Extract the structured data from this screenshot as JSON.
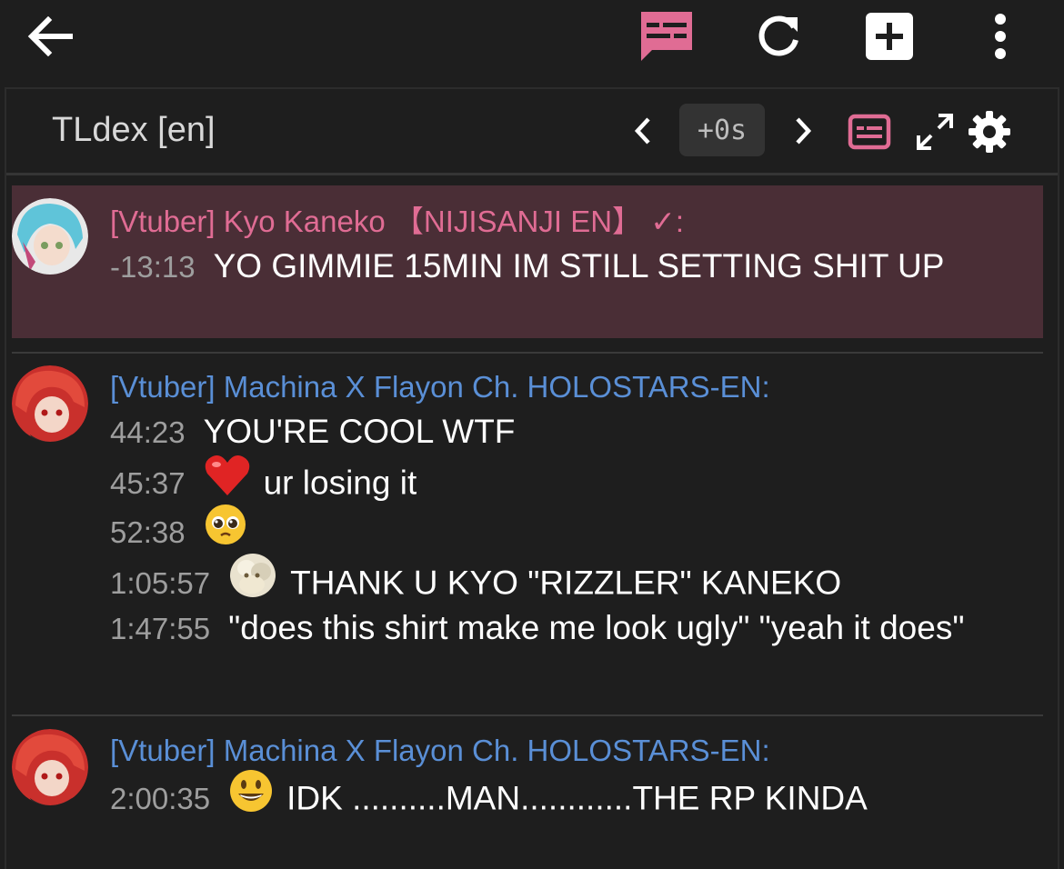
{
  "colors": {
    "accent": "#e06c94",
    "author_pink": "#e06c94",
    "author_blue": "#5a8fd6",
    "highlight": "#4a2e36",
    "timestamp": "#9e9e9e"
  },
  "appbar": {
    "back_icon": "arrow-left-icon",
    "icons": [
      "subtitles-icon",
      "refresh-icon",
      "add-box-icon",
      "more-vertical-icon"
    ]
  },
  "panel": {
    "title": "TLdex [en]",
    "offset": "+0s"
  },
  "messages": [
    {
      "author": "[Vtuber] Kyo Kaneko 【NIJISANJI EN】 ✓:",
      "lines": [
        {
          "time": "-13:13",
          "text": "YO GIMMIE 15MIN IM STILL SETTING SHIT UP",
          "emoji": ""
        }
      ]
    },
    {
      "author": "[Vtuber] Machina X Flayon Ch. HOLOSTARS-EN:",
      "lines": [
        {
          "time": "44:23",
          "text": "YOU'RE COOL WTF",
          "emoji": ""
        },
        {
          "time": "45:37",
          "text": "ur losing it",
          "emoji": "red-heart"
        },
        {
          "time": "52:38",
          "text": "",
          "emoji": "pleading-face"
        },
        {
          "time": "1:05:57",
          "text": "THANK U KYO \"RIZZLER\" KANEKO",
          "emoji": "custom-emote"
        },
        {
          "time": "1:47:55",
          "text": "\"does this shirt make me look ugly\" \"yeah it does\"",
          "emoji": ""
        }
      ]
    },
    {
      "author": "[Vtuber] Machina X Flayon Ch. HOLOSTARS-EN:",
      "lines": [
        {
          "time": "2:00:35",
          "text": "IDK ..........MAN............THE RP KINDA",
          "emoji": "grinning-face"
        }
      ]
    }
  ]
}
